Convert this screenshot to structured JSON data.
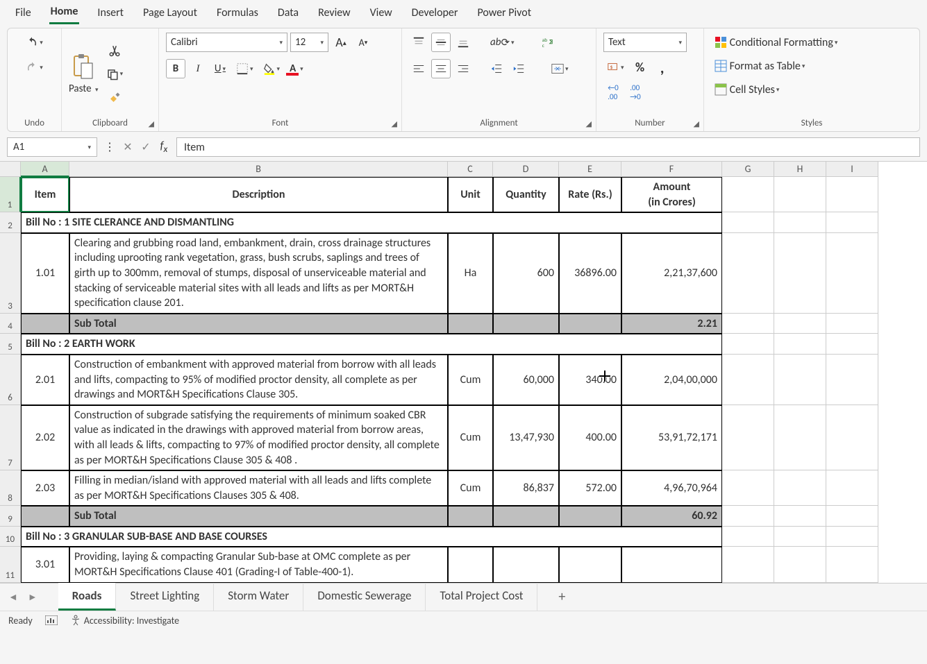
{
  "menubar": [
    "File",
    "Home",
    "Insert",
    "Page Layout",
    "Formulas",
    "Data",
    "Review",
    "View",
    "Developer",
    "Power Pivot"
  ],
  "active_menu": "Home",
  "ribbon": {
    "undo_label": "Undo",
    "clipboard_label": "Clipboard",
    "paste_label": "Paste",
    "font_label": "Font",
    "font_name": "Calibri",
    "font_size": "12",
    "alignment_label": "Alignment",
    "number_label": "Number",
    "number_format": "Text",
    "styles_label": "Styles",
    "cond_fmt": "Conditional Formatting",
    "fmt_table": "Format as Table",
    "cell_styles": "Cell Styles"
  },
  "namebox": "A1",
  "formula": "Item",
  "columns": [
    "A",
    "B",
    "C",
    "D",
    "E",
    "F",
    "G",
    "H",
    "I"
  ],
  "headers": {
    "item": "Item",
    "desc": "Description",
    "unit": "Unit",
    "qty": "Quantity",
    "rate": "Rate (Rs.)",
    "amt1": "Amount",
    "amt2": "(in Crores)"
  },
  "rows": [
    {
      "rn": "2",
      "type": "bill",
      "text": "Bill No : 1 SITE CLERANCE AND DISMANTLING"
    },
    {
      "rn": "3",
      "type": "data",
      "item": "1.01",
      "desc": "Clearing and grubbing road land, embankment, drain, cross drainage structures including uprooting rank vegetation, grass, bush scrubs, saplings and trees of girth up to 300mm, removal of stumps, disposal of unserviceable material and stacking of serviceable material sites with all leads and lifts as per MORT&H specification clause 201.",
      "unit": "Ha",
      "qty": "600",
      "rate": "36896.00",
      "amt": "2,21,37,600"
    },
    {
      "rn": "4",
      "type": "sub",
      "desc": "Sub Total",
      "amt": "2.21"
    },
    {
      "rn": "5",
      "type": "bill",
      "text": "Bill No : 2 EARTH WORK"
    },
    {
      "rn": "6",
      "type": "data",
      "item": "2.01",
      "desc": "Construction of embankment with approved material from borrow with all leads and lifts, compacting to 95% of modified proctor density, all complete as per drawings and MORT&H Specifications Clause 305.",
      "unit": "Cum",
      "qty": "60,000",
      "rate": "340.00",
      "amt": "2,04,00,000"
    },
    {
      "rn": "7",
      "type": "data",
      "item": "2.02",
      "desc": "Construction of subgrade satisfying the requirements of minimum soaked CBR value as indicated in the drawings with approved material from borrow areas, with all leads & lifts, compacting to 97% of modified proctor density, all complete as per MORT&H Specifications Clause 305 & 408 .",
      "unit": "Cum",
      "qty": "13,47,930",
      "rate": "400.00",
      "amt": "53,91,72,171"
    },
    {
      "rn": "8",
      "type": "data",
      "item": "2.03",
      "desc": "Filling in median/island with approved material with all leads and lifts complete as per MORT&H Specifications Clauses 305 & 408.",
      "unit": "Cum",
      "qty": "86,837",
      "rate": "572.00",
      "amt": "4,96,70,964"
    },
    {
      "rn": "9",
      "type": "sub",
      "desc": "Sub Total",
      "amt": "60.92"
    },
    {
      "rn": "10",
      "type": "bill",
      "text": "Bill No : 3 GRANULAR SUB-BASE AND BASE COURSES"
    },
    {
      "rn": "11",
      "type": "data",
      "item": "3.01",
      "desc": "Providing, laying & compacting Granular Sub-base at OMC complete as per MORT&H Specifications Clause 401 (Grading-I of Table-400-1).",
      "unit": "",
      "qty": "",
      "rate": "",
      "amt": ""
    }
  ],
  "sheets": [
    "Roads",
    "Street Lighting",
    "Storm Water",
    "Domestic Sewerage",
    "Total Project Cost"
  ],
  "active_sheet": "Roads",
  "status": {
    "ready": "Ready",
    "access": "Accessibility: Investigate"
  }
}
